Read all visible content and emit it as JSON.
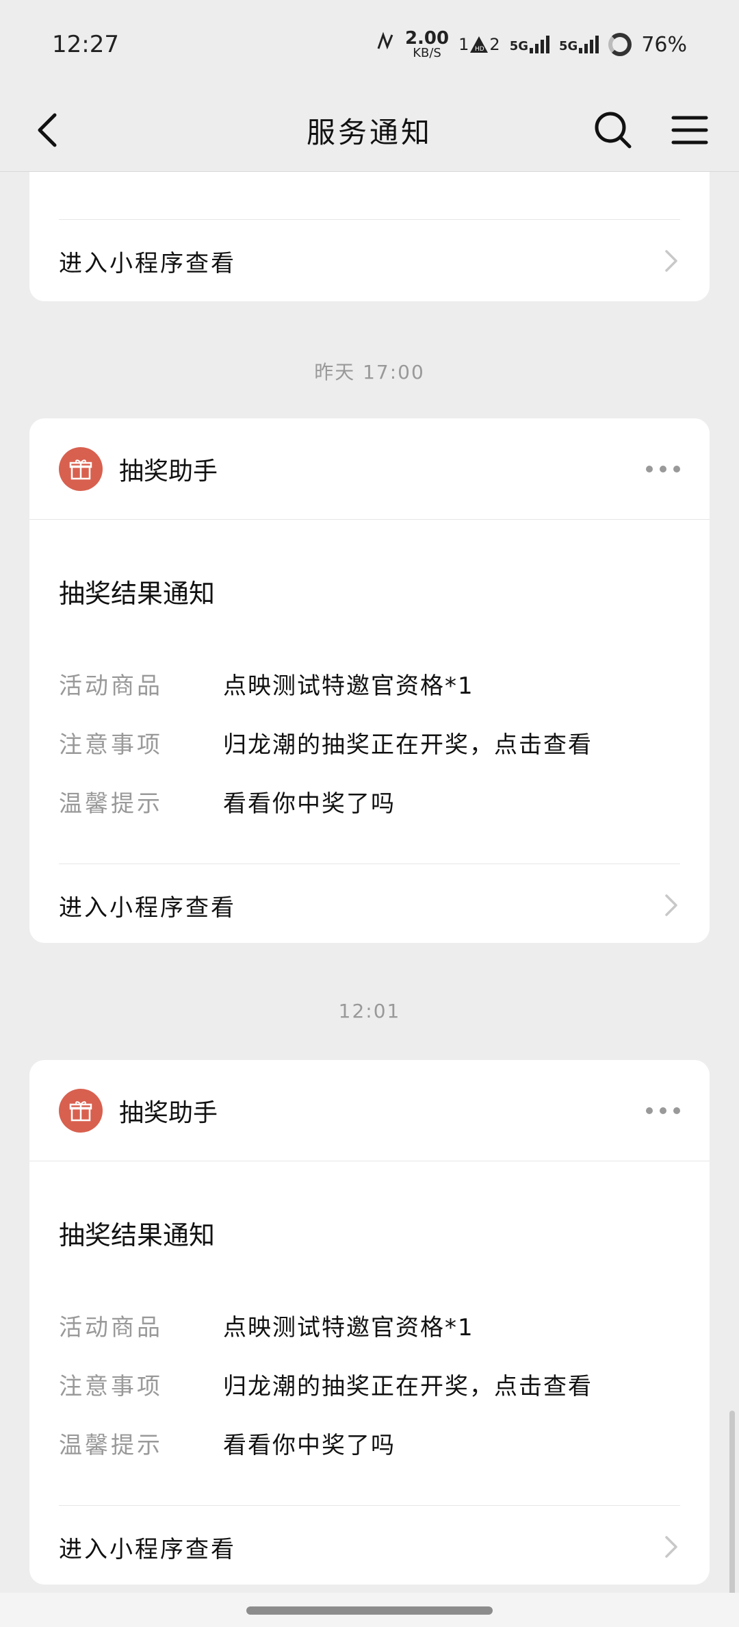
{
  "status_bar": {
    "time": "12:27",
    "net_speed_value": "2.00",
    "net_speed_unit": "KB/S",
    "sim1": "1",
    "sim2": "2",
    "network1": "5G",
    "network2": "5G",
    "battery": "76%"
  },
  "nav": {
    "title": "服务通知"
  },
  "partial_card": {
    "entry_label": "进入小程序查看"
  },
  "messages": [
    {
      "timestamp": "昨天 17:00",
      "app_name": "抽奖助手",
      "title": "抽奖结果通知",
      "fields": [
        {
          "key": "活动商品",
          "value": "点映测试特邀官资格*1"
        },
        {
          "key": "注意事项",
          "value": "归龙潮的抽奖正在开奖，点击查看"
        },
        {
          "key": "温馨提示",
          "value": "看看你中奖了吗"
        }
      ],
      "entry_label": "进入小程序查看"
    },
    {
      "timestamp": "12:01",
      "app_name": "抽奖助手",
      "title": "抽奖结果通知",
      "fields": [
        {
          "key": "活动商品",
          "value": "点映测试特邀官资格*1"
        },
        {
          "key": "注意事项",
          "value": "归龙潮的抽奖正在开奖，点击查看"
        },
        {
          "key": "温馨提示",
          "value": "看看你中奖了吗"
        }
      ],
      "entry_label": "进入小程序查看"
    }
  ],
  "colors": {
    "background": "#ededed",
    "card": "#ffffff",
    "avatar": "#d8604f",
    "muted_text": "#999999"
  }
}
